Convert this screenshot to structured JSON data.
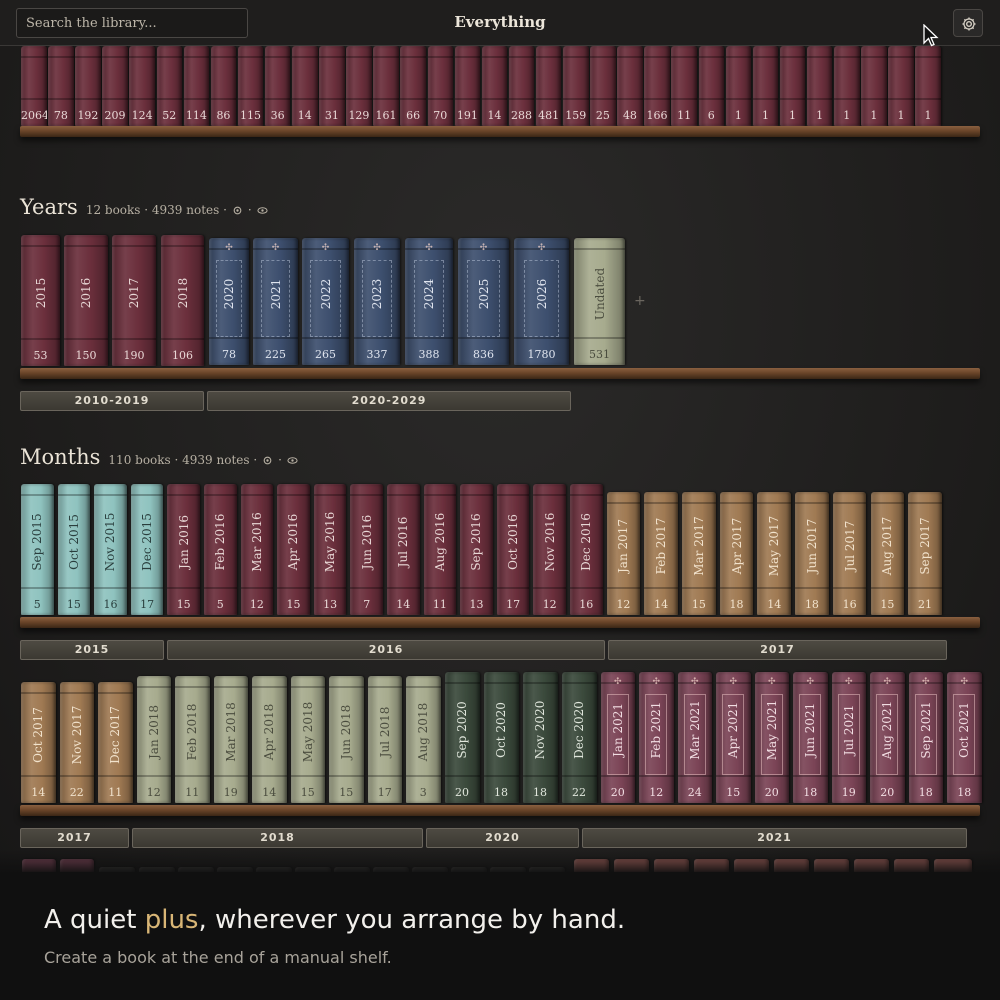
{
  "header": {
    "search_placeholder": "Search the library...",
    "title": "Everything"
  },
  "top_shelf": {
    "counts": [
      "2064",
      "78",
      "192",
      "209",
      "124",
      "52",
      "114",
      "86",
      "115",
      "36",
      "14",
      "31",
      "129",
      "161",
      "66",
      "70",
      "191",
      "14",
      "288",
      "481",
      "159",
      "25",
      "48",
      "166",
      "11",
      "6",
      "1",
      "1",
      "1",
      "1",
      "1",
      "1",
      "1",
      "1"
    ]
  },
  "years": {
    "name": "Years",
    "meta": "12 books · 4939 notes ·",
    "books": [
      {
        "label": "2015",
        "count": "53",
        "style": "maroon"
      },
      {
        "label": "2016",
        "count": "150",
        "style": "maroon"
      },
      {
        "label": "2017",
        "count": "190",
        "style": "maroon"
      },
      {
        "label": "2018",
        "count": "106",
        "style": "maroon"
      },
      {
        "label": "2020",
        "count": "78",
        "style": "blue"
      },
      {
        "label": "2021",
        "count": "225",
        "style": "blue"
      },
      {
        "label": "2022",
        "count": "265",
        "style": "blue"
      },
      {
        "label": "2023",
        "count": "337",
        "style": "blue"
      },
      {
        "label": "2024",
        "count": "388",
        "style": "blue"
      },
      {
        "label": "2025",
        "count": "836",
        "style": "blue"
      },
      {
        "label": "2026",
        "count": "1780",
        "style": "blue"
      },
      {
        "label": "Undated",
        "count": "531",
        "style": "sage"
      }
    ],
    "groups": [
      "2010-2019",
      "2020-2029"
    ]
  },
  "months": {
    "name": "Months",
    "meta": "110 books · 4939 notes ·",
    "row1": [
      {
        "label": "Sep 2015",
        "count": "5",
        "style": "teal"
      },
      {
        "label": "Oct 2015",
        "count": "15",
        "style": "teal"
      },
      {
        "label": "Nov 2015",
        "count": "16",
        "style": "teal"
      },
      {
        "label": "Dec 2015",
        "count": "17",
        "style": "teal"
      },
      {
        "label": "Jan 2016",
        "count": "15",
        "style": "maroon"
      },
      {
        "label": "Feb 2016",
        "count": "5",
        "style": "maroon"
      },
      {
        "label": "Mar 2016",
        "count": "12",
        "style": "maroon"
      },
      {
        "label": "Apr 2016",
        "count": "15",
        "style": "maroon"
      },
      {
        "label": "May 2016",
        "count": "13",
        "style": "maroon"
      },
      {
        "label": "Jun 2016",
        "count": "7",
        "style": "maroon"
      },
      {
        "label": "Jul 2016",
        "count": "14",
        "style": "maroon"
      },
      {
        "label": "Aug 2016",
        "count": "11",
        "style": "maroon"
      },
      {
        "label": "Sep 2016",
        "count": "13",
        "style": "maroon"
      },
      {
        "label": "Oct 2016",
        "count": "17",
        "style": "maroon"
      },
      {
        "label": "Nov 2016",
        "count": "12",
        "style": "maroon"
      },
      {
        "label": "Dec 2016",
        "count": "16",
        "style": "maroon"
      },
      {
        "label": "Jan 2017",
        "count": "12",
        "style": "tan"
      },
      {
        "label": "Feb 2017",
        "count": "14",
        "style": "tan"
      },
      {
        "label": "Mar 2017",
        "count": "15",
        "style": "tan"
      },
      {
        "label": "Apr 2017",
        "count": "18",
        "style": "tan"
      },
      {
        "label": "May 2017",
        "count": "14",
        "style": "tan"
      },
      {
        "label": "Jun 2017",
        "count": "18",
        "style": "tan"
      },
      {
        "label": "Jul 2017",
        "count": "16",
        "style": "tan"
      },
      {
        "label": "Aug 2017",
        "count": "15",
        "style": "tan"
      },
      {
        "label": "Sep 2017",
        "count": "21",
        "style": "tan"
      }
    ],
    "row1_groups": [
      "2015",
      "2016",
      "2017"
    ],
    "row2": [
      {
        "label": "Oct 2017",
        "count": "14",
        "style": "tan"
      },
      {
        "label": "Nov 2017",
        "count": "22",
        "style": "tan"
      },
      {
        "label": "Dec 2017",
        "count": "11",
        "style": "tan"
      },
      {
        "label": "Jan 2018",
        "count": "12",
        "style": "sage"
      },
      {
        "label": "Feb 2018",
        "count": "11",
        "style": "sage"
      },
      {
        "label": "Mar 2018",
        "count": "19",
        "style": "sage"
      },
      {
        "label": "Apr 2018",
        "count": "14",
        "style": "sage"
      },
      {
        "label": "May 2018",
        "count": "15",
        "style": "sage"
      },
      {
        "label": "Jun 2018",
        "count": "15",
        "style": "sage"
      },
      {
        "label": "Jul 2018",
        "count": "17",
        "style": "sage"
      },
      {
        "label": "Aug 2018",
        "count": "3",
        "style": "sage"
      },
      {
        "label": "Sep 2020",
        "count": "20",
        "style": "green"
      },
      {
        "label": "Oct 2020",
        "count": "18",
        "style": "green"
      },
      {
        "label": "Nov 2020",
        "count": "18",
        "style": "green"
      },
      {
        "label": "Dec 2020",
        "count": "22",
        "style": "green"
      },
      {
        "label": "Jan 2021",
        "count": "20",
        "style": "plum"
      },
      {
        "label": "Feb 2021",
        "count": "12",
        "style": "plum"
      },
      {
        "label": "Mar 2021",
        "count": "24",
        "style": "plum"
      },
      {
        "label": "Apr 2021",
        "count": "15",
        "style": "plum"
      },
      {
        "label": "May 2021",
        "count": "20",
        "style": "plum"
      },
      {
        "label": "Jun 2021",
        "count": "18",
        "style": "plum"
      },
      {
        "label": "Jul 2021",
        "count": "19",
        "style": "plum"
      },
      {
        "label": "Aug 2021",
        "count": "20",
        "style": "plum"
      },
      {
        "label": "Sep 2021",
        "count": "18",
        "style": "plum"
      },
      {
        "label": "Oct 2021",
        "count": "18",
        "style": "plum"
      }
    ],
    "row2_groups": [
      "2017",
      "2018",
      "2020",
      "2021"
    ]
  },
  "caption": {
    "title_before": "A quiet ",
    "title_highlight": "plus",
    "title_after": ", wherever you arrange by hand.",
    "subtitle": "Create a book at the end of a manual shelf."
  },
  "colors": {
    "maroon": "#6b2f3c",
    "blue": "#3d4f6e",
    "sage": "#a7ab8e",
    "teal": "#8fc3bf",
    "tan": "#a07a53",
    "green": "#3b4a3c",
    "plum": "#7b4456",
    "accent": "#d9b676"
  },
  "icons": {
    "settings": "gear-icon",
    "visibility": "eye-icon",
    "add": "plus-icon",
    "pointer": "cursor-icon"
  }
}
